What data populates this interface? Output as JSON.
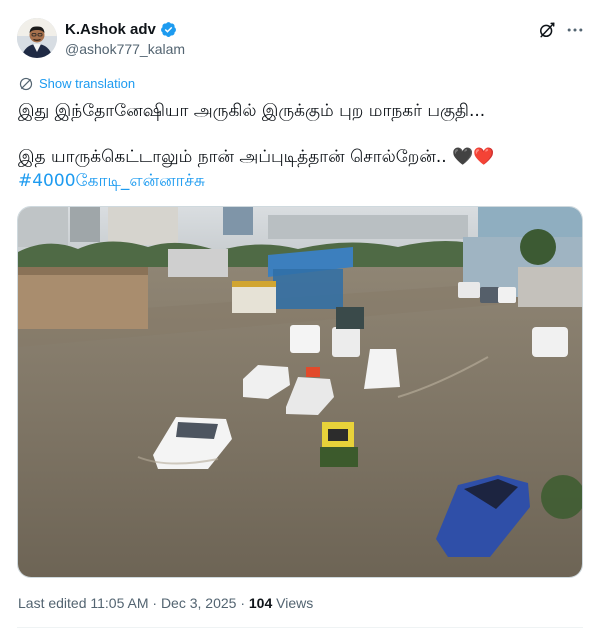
{
  "author": {
    "name": "K.Ashok adv",
    "handle": "@ashok777_kalam",
    "verified": true,
    "avatar_icon": "profile-photo"
  },
  "actions": {
    "grok_icon": "grok-icon",
    "more_icon": "more-icon"
  },
  "translation": {
    "label": "Show translation",
    "icon": "translate-icon"
  },
  "post": {
    "line1": "இது இந்தோனேஷியா அருகில் இருக்கும் புற மாநகர் பகுதி...",
    "line2": "இத யாருக்கெட்டாலும் நான் அப்புடித்தான் சொல்றேன்..",
    "emojis": "🖤❤️",
    "hashtag": "#4000கோடி_என்னாச்சு"
  },
  "media": {
    "type": "photo",
    "description_icon": "flooded-street-photo"
  },
  "meta": {
    "edited": "Last edited 11:05 AM · Dec 3, 2025 · ",
    "views_count": "104",
    "views_label": " Views"
  },
  "colors": {
    "accent": "#1d9bf0",
    "muted": "#536471",
    "text": "#0f1419"
  }
}
